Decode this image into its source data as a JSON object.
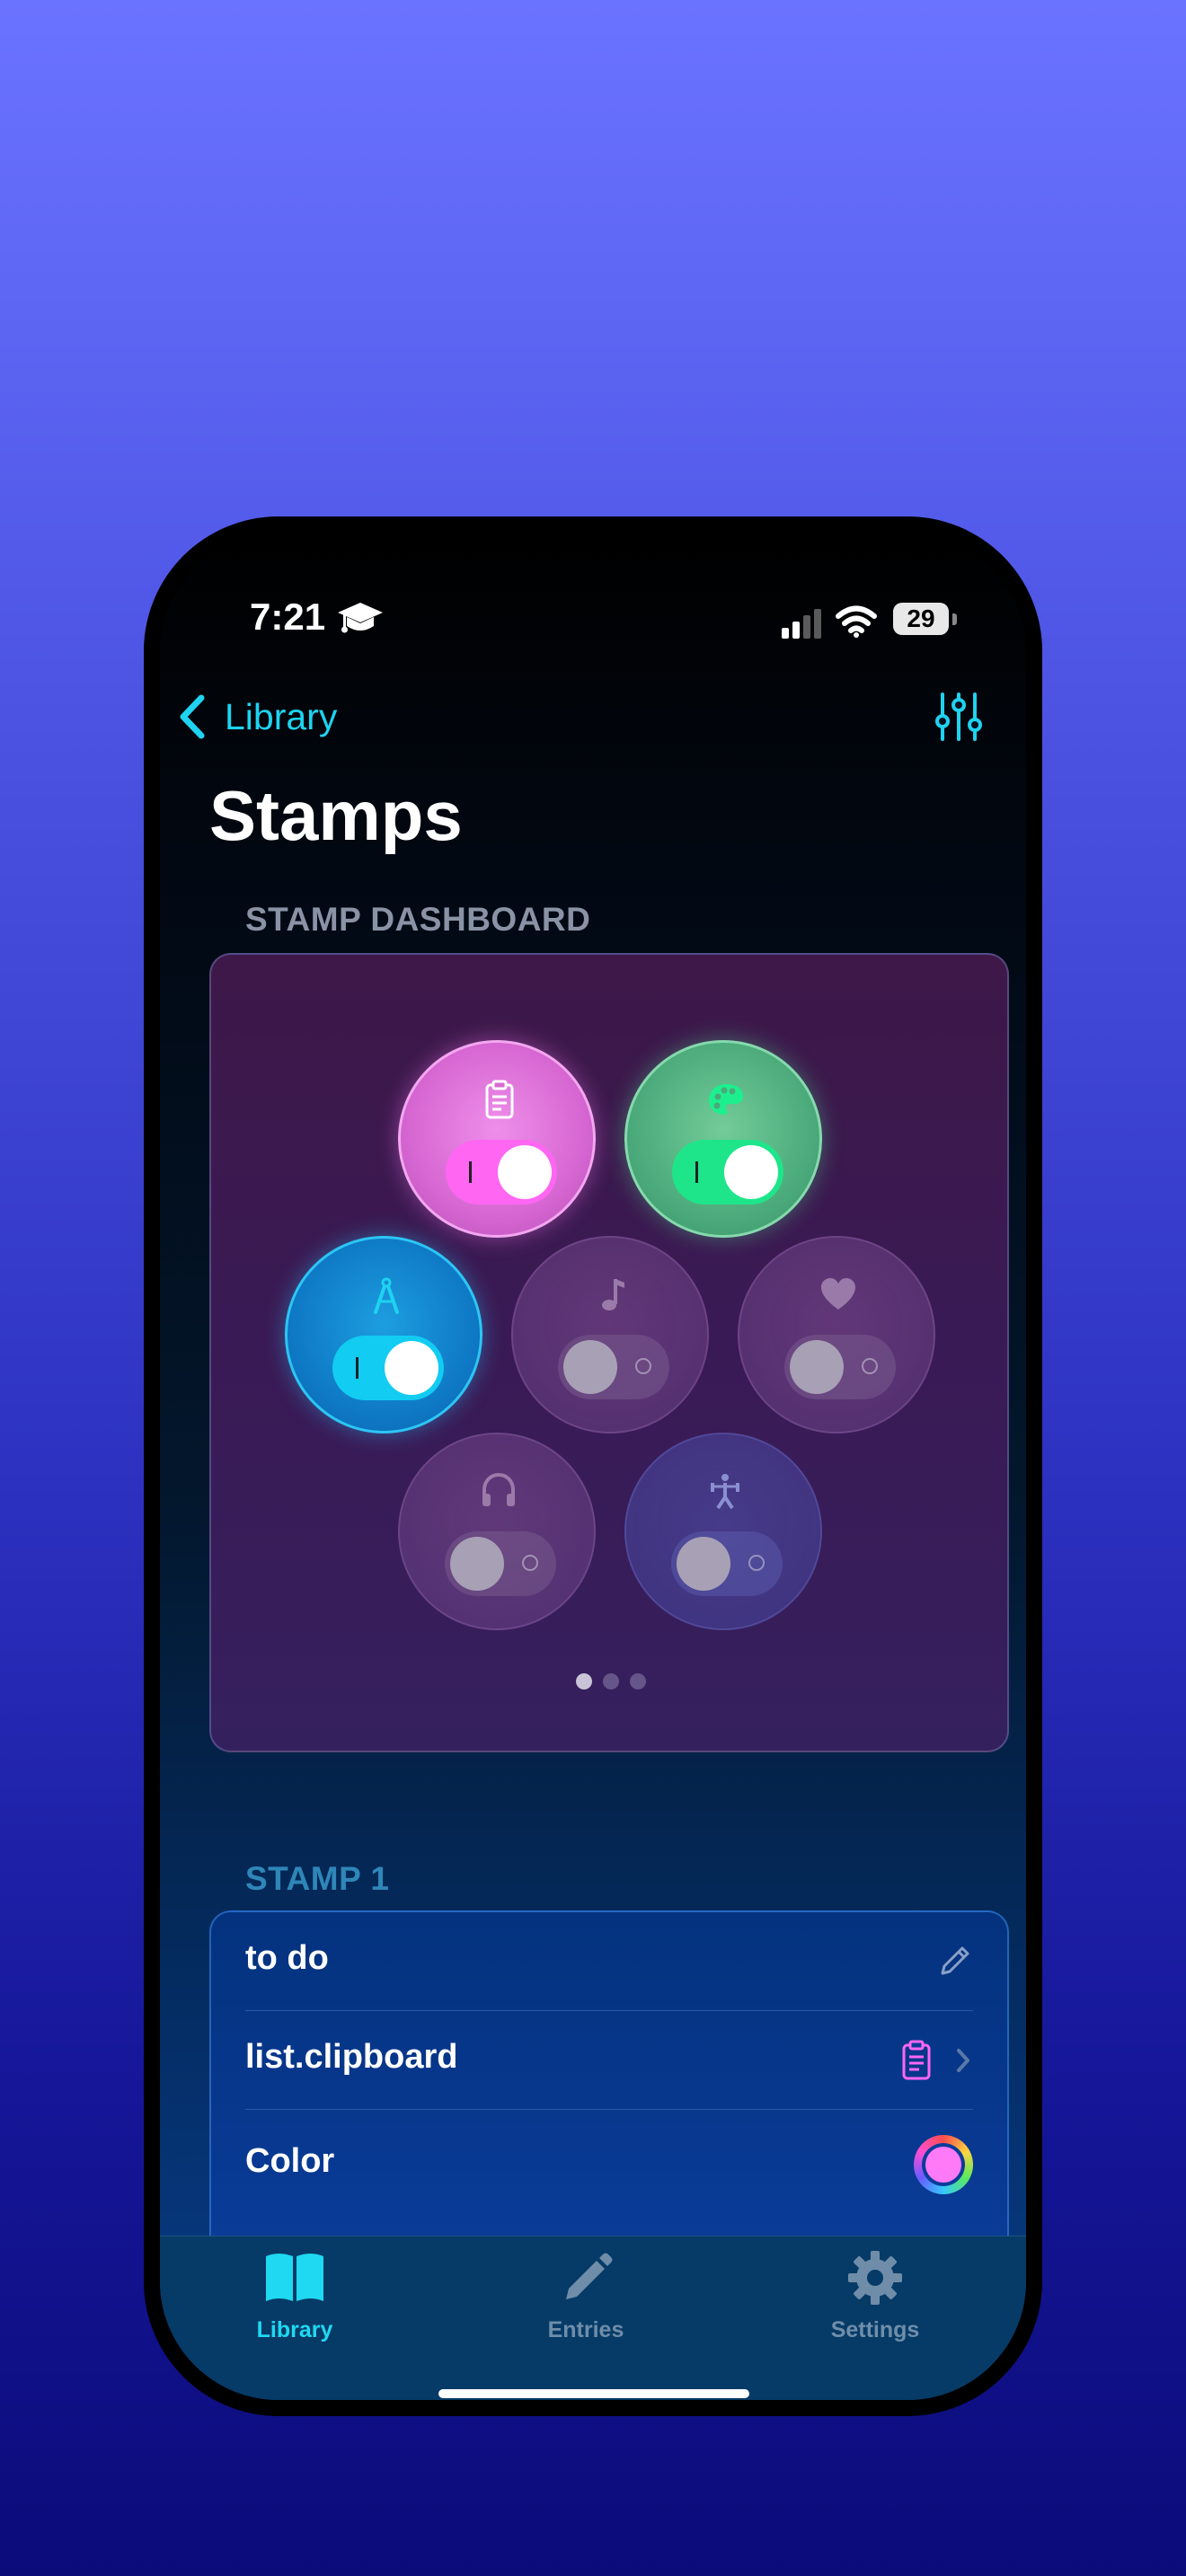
{
  "status_bar": {
    "time": "7:21",
    "battery": "29"
  },
  "nav": {
    "back_label": "Library",
    "title": "Stamps"
  },
  "dashboard": {
    "section_label": "STAMP DASHBOARD",
    "bubbles": [
      {
        "icon": "clipboard-icon",
        "color": "#e57ae2",
        "enabled": true
      },
      {
        "icon": "palette-icon",
        "color": "#4fbf84",
        "enabled": true
      },
      {
        "icon": "compass-icon",
        "color": "#0e8fd8",
        "enabled": true
      },
      {
        "icon": "music-note-icon",
        "color": "#6e4a86",
        "enabled": false
      },
      {
        "icon": "heart-icon",
        "color": "#6e4a86",
        "enabled": false
      },
      {
        "icon": "headphones-icon",
        "color": "#6e4a86",
        "enabled": false
      },
      {
        "icon": "figure-icon",
        "color": "#4d4f9e",
        "enabled": false
      }
    ],
    "page_indicator": {
      "current": 1,
      "total": 3
    }
  },
  "stamp1": {
    "section_label": "STAMP 1",
    "name": "to do",
    "symbol": "list.clipboard",
    "color_label": "Color",
    "color_value": "#ff7af7"
  },
  "tabbar": {
    "items": [
      {
        "label": "Library",
        "icon": "book-icon",
        "active": true
      },
      {
        "label": "Entries",
        "icon": "pencil-icon",
        "active": false
      },
      {
        "label": "Settings",
        "icon": "gear-icon",
        "active": false
      }
    ]
  },
  "colors": {
    "accent": "#1ed3f0",
    "background_top": "#6a73ff",
    "background_bottom": "#0c0b7a"
  }
}
